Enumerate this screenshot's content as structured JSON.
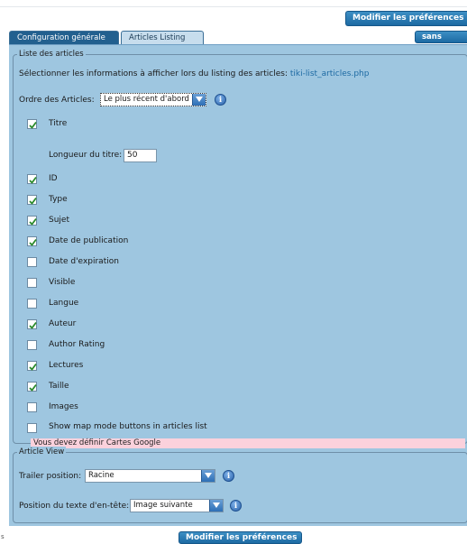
{
  "header": {
    "save_button": "Modifier les préférences",
    "no_tabs_button": "sans onglet"
  },
  "tabs": [
    {
      "label": "Configuration générale",
      "active": false
    },
    {
      "label": "Articles Listing",
      "active": true
    }
  ],
  "list_section": {
    "legend": "Liste des articles",
    "intro_text": "Sélectionner les informations à afficher lors du listing des articles:",
    "intro_link": "tiki-list_articles.php",
    "order_label": "Ordre des Articles:",
    "order_value": "Le plus récent d'abord",
    "title_length_label": "Longueur du titre:",
    "title_length_value": "50",
    "options": [
      {
        "label": "Titre",
        "checked": true
      },
      {
        "label": "ID",
        "checked": true
      },
      {
        "label": "Type",
        "checked": true
      },
      {
        "label": "Sujet",
        "checked": true
      },
      {
        "label": "Date de publication",
        "checked": true
      },
      {
        "label": "Date d'expiration",
        "checked": false
      },
      {
        "label": "Visible",
        "checked": false
      },
      {
        "label": "Langue",
        "checked": false
      },
      {
        "label": "Auteur",
        "checked": true
      },
      {
        "label": "Author Rating",
        "checked": false
      },
      {
        "label": "Lectures",
        "checked": true
      },
      {
        "label": "Taille",
        "checked": true
      },
      {
        "label": "Images",
        "checked": false
      },
      {
        "label": "Show map mode buttons in articles list",
        "checked": false
      }
    ],
    "warning": "Vous devez définir Cartes Google"
  },
  "view_section": {
    "legend": "Article View",
    "trailer_label": "Trailer position:",
    "trailer_value": "Racine",
    "header_text_label": "Position du texte d'en-tête:",
    "header_text_value": "Image suivante"
  },
  "footer": {
    "save_button": "Modifier les préférences",
    "side_mark": "s"
  },
  "icons": {
    "info": "information-icon",
    "check": "checkmark-icon",
    "dropdown": "chevron-down-icon"
  },
  "colors": {
    "panel_bg": "#9ec6e0",
    "button_blue": "#1d6aa3",
    "warning_bg": "#fbd1dc",
    "check_green": "#2a8a2a"
  }
}
